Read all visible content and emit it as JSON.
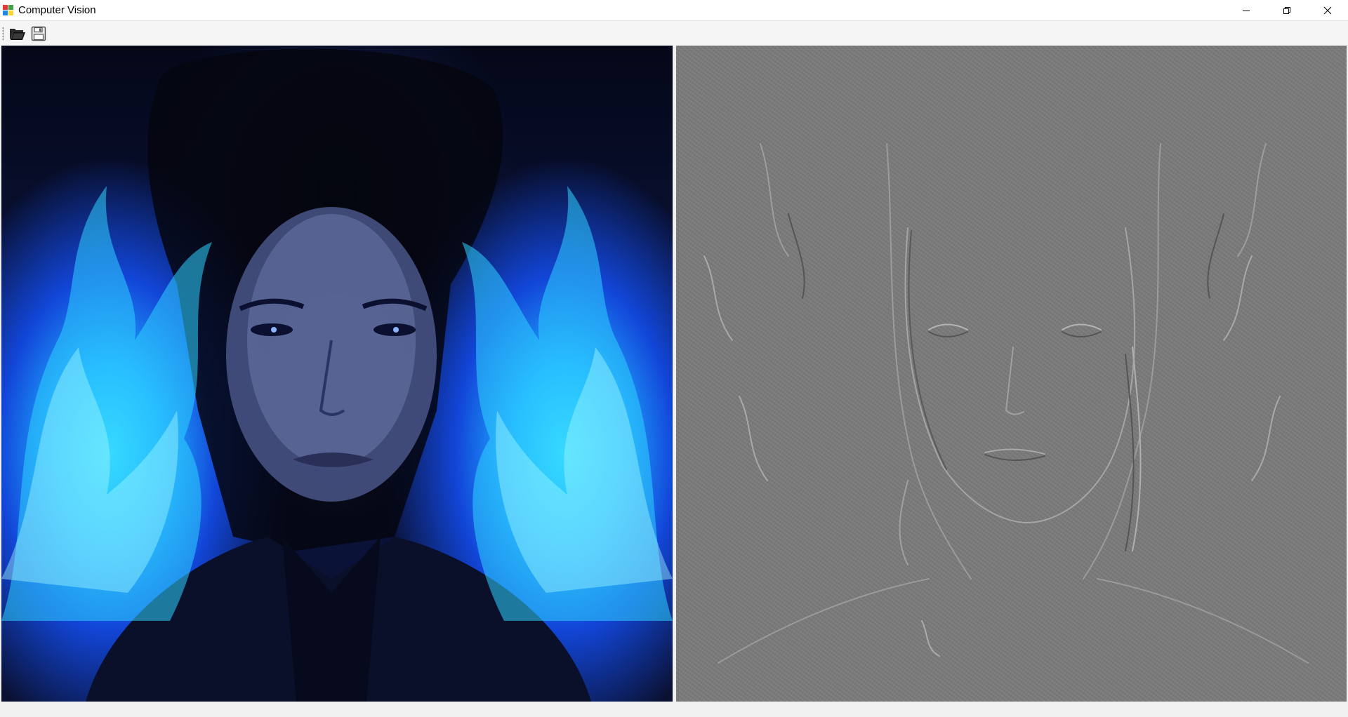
{
  "window": {
    "title": "Computer Vision",
    "icon": "app-window-icon"
  },
  "window_controls": [
    {
      "name": "minimize-button",
      "icon": "minimize-icon"
    },
    {
      "name": "restore-button",
      "icon": "restore-icon"
    },
    {
      "name": "close-button",
      "icon": "close-icon"
    }
  ],
  "toolbar": {
    "buttons": [
      {
        "name": "open-file-button",
        "icon": "open-folder-icon"
      },
      {
        "name": "save-file-button",
        "icon": "floppy-disk-icon"
      }
    ]
  },
  "images": {
    "original": {
      "description_icon": "photo-original",
      "dominant_colors": [
        "#0a1030",
        "#1246d8",
        "#3fe3ff",
        "#5f6b9e"
      ]
    },
    "processed": {
      "description_icon": "photo-edge-filtered",
      "dominant_colors": [
        "#7d7d7d",
        "#5a5a5a",
        "#a8a8a8"
      ]
    }
  }
}
